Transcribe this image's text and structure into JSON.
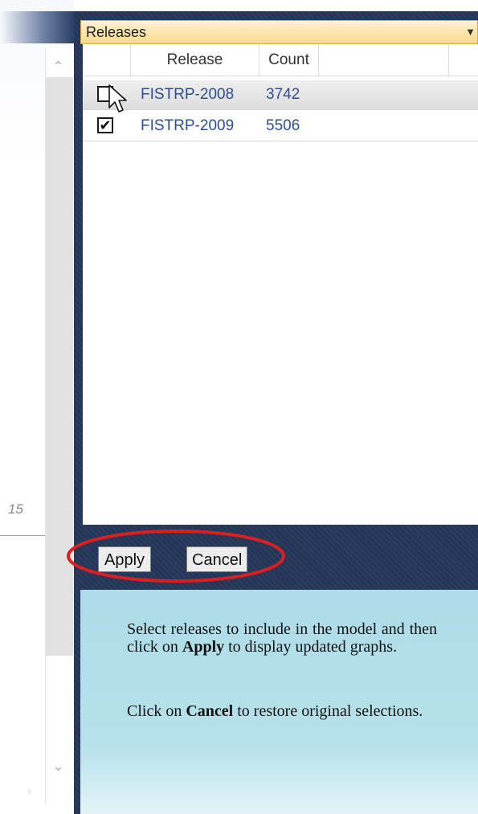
{
  "releases_panel": {
    "header_title": "Releases",
    "columns": [
      "Release",
      "Count"
    ],
    "rows": [
      {
        "release": "FISTRP-2008",
        "count": "3742",
        "checked": false,
        "selected": true
      },
      {
        "release": "FISTRP-2009",
        "count": "5506",
        "checked": true,
        "selected": false
      }
    ]
  },
  "buttons": {
    "apply_label": "Apply",
    "cancel_label": "Cancel"
  },
  "help_text": {
    "p1_pre": "Select releases to include in the model and then click on ",
    "p1_bold": "Apply",
    "p1_post": " to display updated graphs.",
    "p2_pre": "Click on ",
    "p2_bold": "Cancel",
    "p2_post": " to restore original selections."
  },
  "left_pane": {
    "axis_tick": "15"
  },
  "icons": {
    "filter": "filter-icon",
    "dropdown": "chevron-down-icon",
    "scroll_up": "chevron-up-icon",
    "scroll_down": "chevron-down-icon",
    "checkmark": "checkmark-icon",
    "cursor": "mouse-pointer-icon"
  },
  "colors": {
    "panel_navy": "#243658",
    "header_gold": "#fbd98a",
    "link_blue": "#2d4f91",
    "help_bg": "#acdce8",
    "highlight_red": "#d91f1f"
  }
}
